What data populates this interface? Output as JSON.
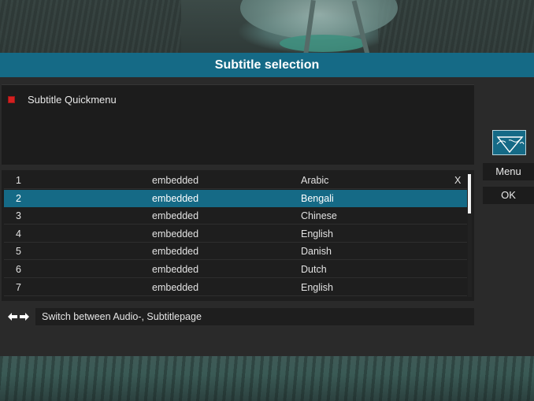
{
  "dialog": {
    "title": "Subtitle selection",
    "quickmenu_label": "Subtitle Quickmenu",
    "hint": "Switch between Audio-, Subtitlepage"
  },
  "side": {
    "menu_label": "Menu",
    "ok_label": "OK"
  },
  "tracks": [
    {
      "num": "1",
      "type": "embedded",
      "lang": "Arabic",
      "mark": "X",
      "selected": false
    },
    {
      "num": "2",
      "type": "embedded",
      "lang": "Bengali",
      "mark": "",
      "selected": true
    },
    {
      "num": "3",
      "type": "embedded",
      "lang": "Chinese",
      "mark": "",
      "selected": false
    },
    {
      "num": "4",
      "type": "embedded",
      "lang": "English",
      "mark": "",
      "selected": false
    },
    {
      "num": "5",
      "type": "embedded",
      "lang": "Danish",
      "mark": "",
      "selected": false
    },
    {
      "num": "6",
      "type": "embedded",
      "lang": "Dutch",
      "mark": "",
      "selected": false
    },
    {
      "num": "7",
      "type": "embedded",
      "lang": "English",
      "mark": "",
      "selected": false
    }
  ],
  "icons": {
    "quickmenu": "red-square-icon",
    "hint_left": "arrow-left-icon",
    "hint_right": "arrow-right-icon",
    "logo": "logo-icon"
  },
  "colors": {
    "accent": "#156a86",
    "panel": "#1e1e1e",
    "quickmenu_marker": "#d42020"
  }
}
